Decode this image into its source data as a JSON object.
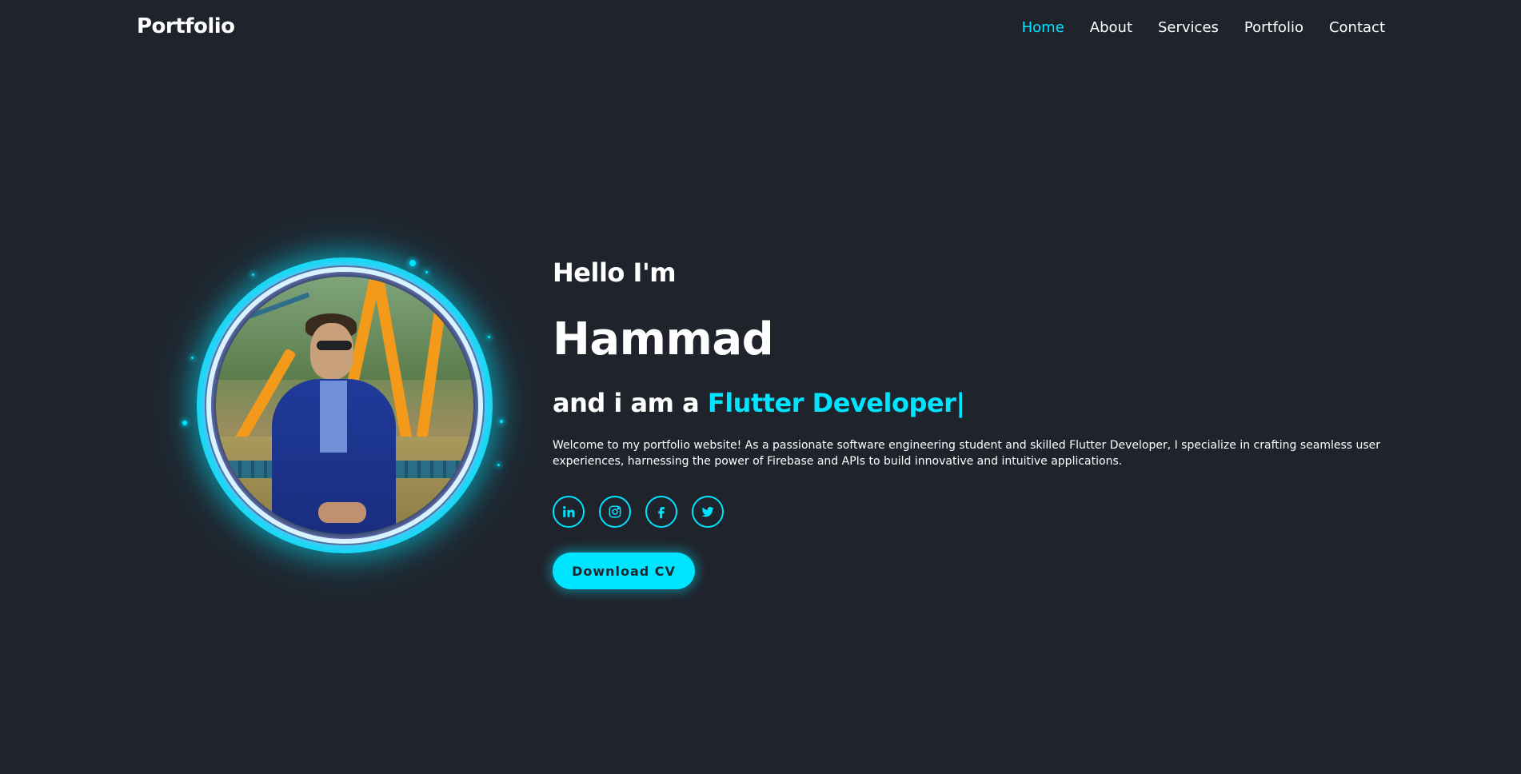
{
  "nav": {
    "logo": "Portfolio",
    "links": [
      "Home",
      "About",
      "Services",
      "Portfolio",
      "Contact"
    ],
    "active": "Home"
  },
  "hero": {
    "greeting": "Hello I'm",
    "name": "Hammad",
    "role_prefix": "and i am a ",
    "role": "Flutter Developer",
    "cursor": "|",
    "intro": "Welcome to my portfolio website! As a passionate software engineering student and skilled Flutter Developer, I specialize in crafting seamless user experiences, harnessing the power of Firebase and APIs to build innovative and intuitive applications.",
    "socials": [
      "linkedin-icon",
      "instagram-icon",
      "facebook-icon",
      "twitter-icon"
    ],
    "cta": "Download CV"
  },
  "colors": {
    "background": "#1f232c",
    "accent": "#00e5ff",
    "text": "#ffffff"
  }
}
